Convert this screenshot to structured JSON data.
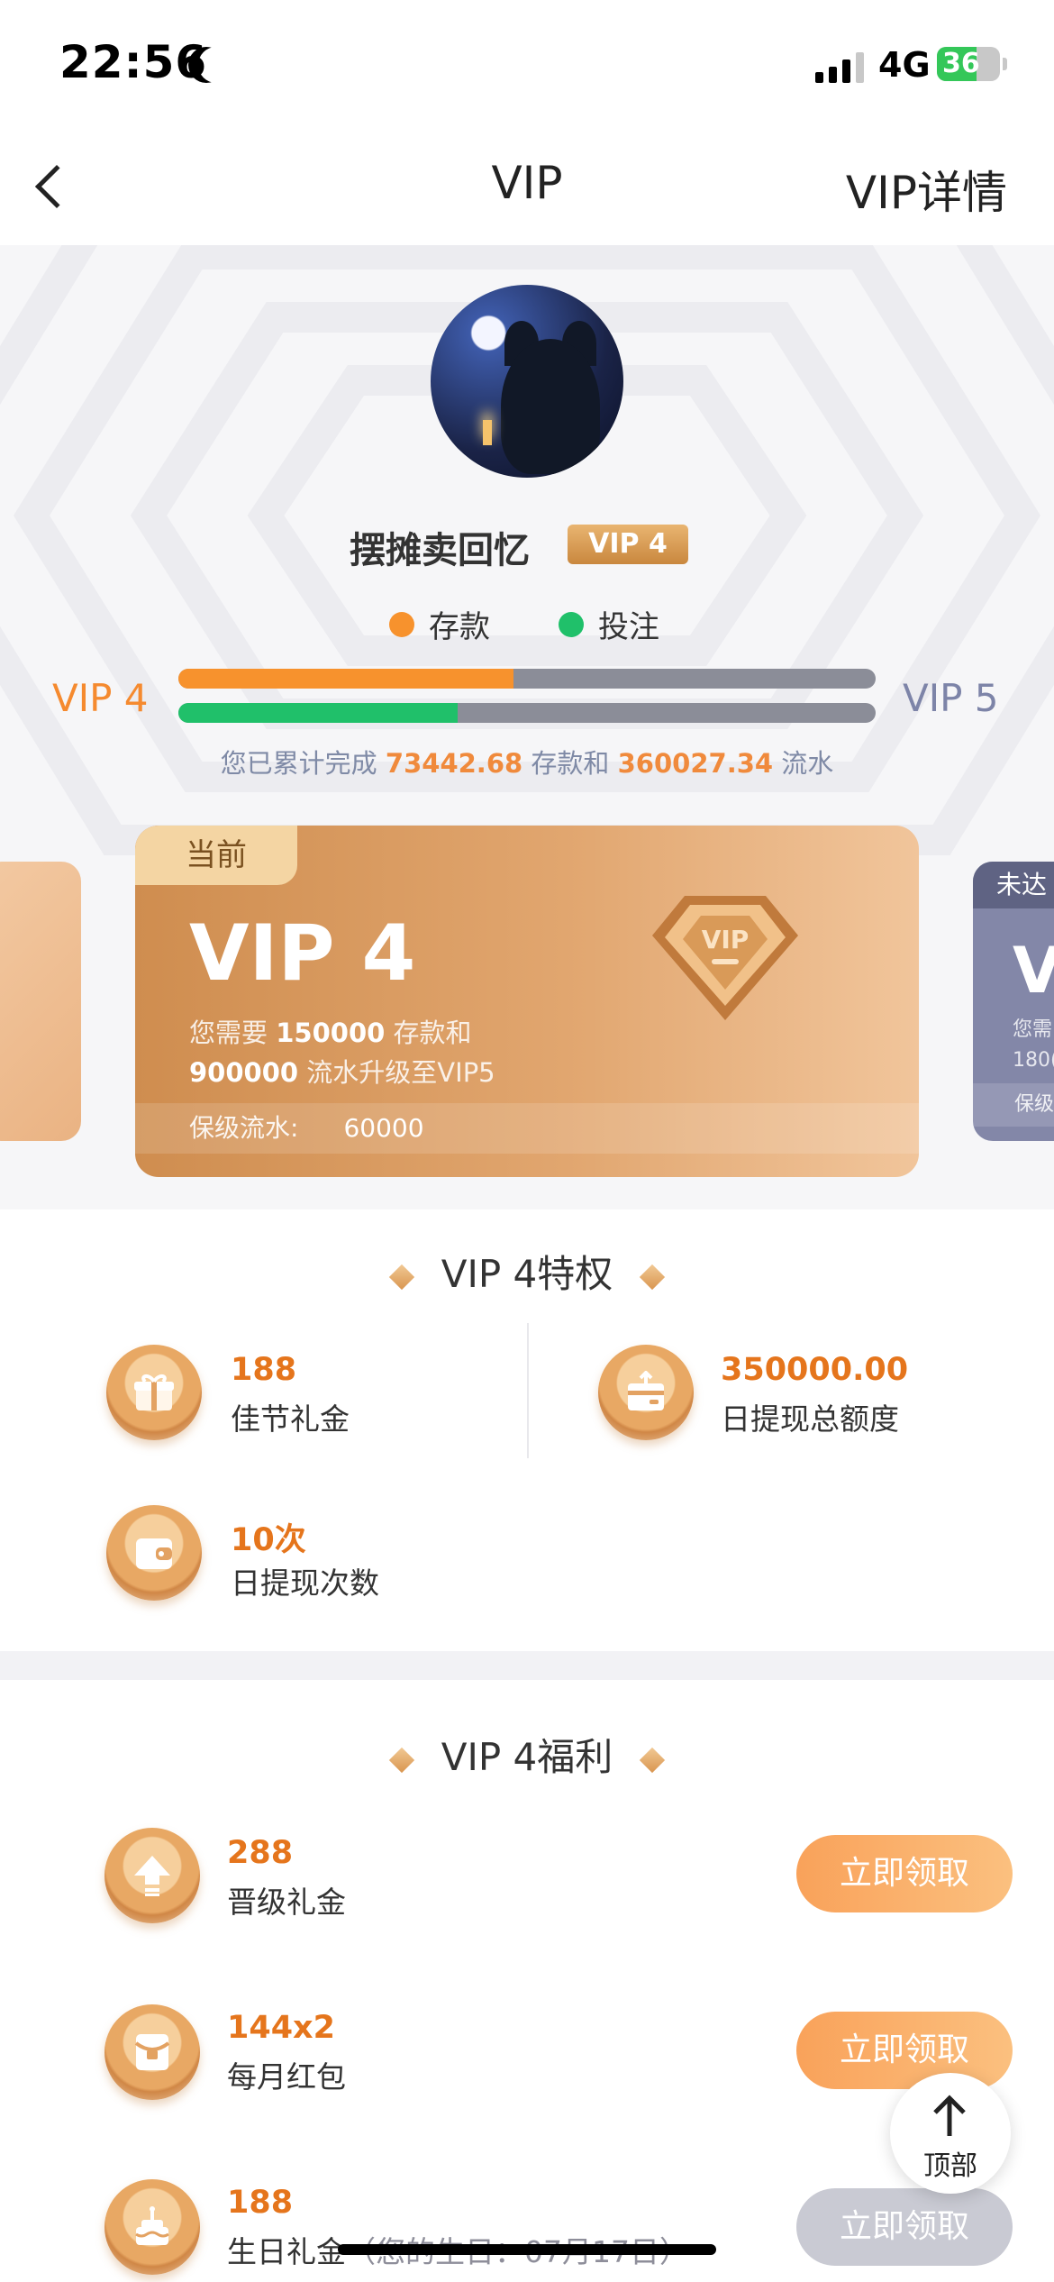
{
  "status_bar": {
    "time": "22:56",
    "network": "4G",
    "battery": "36"
  },
  "nav": {
    "title": "VIP",
    "right_link": "VIP详情"
  },
  "profile": {
    "username": "摆摊卖回忆",
    "vip_badge": "VIP 4"
  },
  "legend": {
    "deposit": "存款",
    "bet": "投注"
  },
  "progress": {
    "current_level": "VIP 4",
    "next_level": "VIP 5",
    "deposit_fraction": 0.48,
    "turnover_fraction": 0.4,
    "summary_prefix": "您已累计完成",
    "deposit_amount": "73442.68",
    "summary_mid": "存款和",
    "turnover_amount": "360027.34",
    "summary_suffix": "流水"
  },
  "card_current": {
    "tag": "当前",
    "level": "VIP 4",
    "desc_prefix": "您需要",
    "need_deposit": "150000",
    "desc_mid": "存款和",
    "need_turnover": "900000",
    "desc_suffix": "流水升级至VIP5",
    "keep_label": "保级流水:",
    "keep_value": "60000"
  },
  "card_next": {
    "tag": "未达",
    "level": "V",
    "desc": "您需",
    "desc2": "180(",
    "strip": "保级"
  },
  "privileges": {
    "title": "VIP 4特权",
    "items": [
      {
        "value": "188",
        "label": "佳节礼金",
        "icon": "gift-icon"
      },
      {
        "value": "350000.00",
        "label": "日提现总额度",
        "icon": "withdraw-limit-icon"
      },
      {
        "value": "10次",
        "label": "日提现次数",
        "icon": "wallet-icon"
      }
    ]
  },
  "benefits": {
    "title": "VIP 4福利",
    "claim_label": "立即领取",
    "items": [
      {
        "value": "288",
        "label": "晋级礼金",
        "icon": "upgrade-icon",
        "enabled": true
      },
      {
        "value": "144x2",
        "label": "每月红包",
        "icon": "red-envelope-icon",
        "enabled": true
      },
      {
        "value": "188",
        "label": "生日礼金",
        "note": "（您的生日：07月17日）",
        "icon": "birthday-cake-icon",
        "enabled": false
      }
    ]
  },
  "back_to_top": {
    "label": "顶部"
  },
  "colors": {
    "accent": "#f58a2f",
    "deposit": "#f7922d",
    "bet": "#20c06a",
    "track": "#8b8d98"
  }
}
